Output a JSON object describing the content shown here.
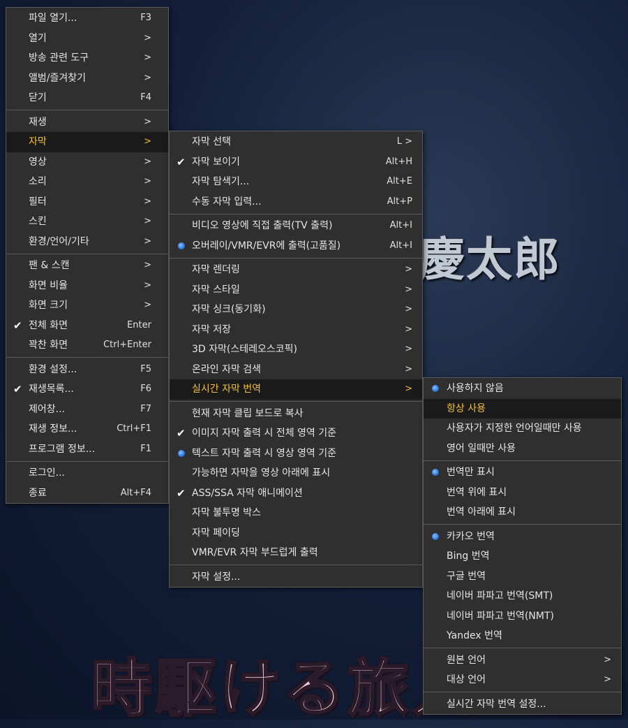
{
  "background": {
    "kanji": "慶太郎",
    "caption": "時駆ける旅人"
  },
  "menu_main": [
    {
      "label": "파일 열기...",
      "shortcut": "F3"
    },
    {
      "label": "열기",
      "shortcut": ">"
    },
    {
      "label": "방송 관련 도구",
      "shortcut": ">"
    },
    {
      "label": "앨범/즐겨찾기",
      "shortcut": ">"
    },
    {
      "label": "닫기",
      "shortcut": "F4"
    },
    {
      "label": "재생",
      "shortcut": ">"
    },
    {
      "label": "자막",
      "shortcut": ">"
    },
    {
      "label": "영상",
      "shortcut": ">"
    },
    {
      "label": "소리",
      "shortcut": ">"
    },
    {
      "label": "필터",
      "shortcut": ">"
    },
    {
      "label": "스킨",
      "shortcut": ">"
    },
    {
      "label": "환경/언어/기타",
      "shortcut": ">"
    },
    {
      "label": "팬 & 스캔",
      "shortcut": ">"
    },
    {
      "label": "화면 비율",
      "shortcut": ">"
    },
    {
      "label": "화면 크기",
      "shortcut": ">"
    },
    {
      "label": "전체 화면",
      "shortcut": "Enter"
    },
    {
      "label": "꽉찬 화면",
      "shortcut": "Ctrl+Enter"
    },
    {
      "label": "환경 설정...",
      "shortcut": "F5"
    },
    {
      "label": "재생목록...",
      "shortcut": "F6"
    },
    {
      "label": "제어창...",
      "shortcut": "F7"
    },
    {
      "label": "재생 정보...",
      "shortcut": "Ctrl+F1"
    },
    {
      "label": "프로그램 정보...",
      "shortcut": "F1"
    },
    {
      "label": "로그인...",
      "shortcut": ""
    },
    {
      "label": "종료",
      "shortcut": "Alt+F4"
    }
  ],
  "menu_subtitle": [
    {
      "label": "자막 선택",
      "shortcut": "L >"
    },
    {
      "label": "자막 보이기",
      "shortcut": "Alt+H"
    },
    {
      "label": "자막 탐색기...",
      "shortcut": "Alt+E"
    },
    {
      "label": "수동 자막 입력...",
      "shortcut": "Alt+P"
    },
    {
      "label": "비디오 영상에 직접 출력(TV 출력)",
      "shortcut": "Alt+I"
    },
    {
      "label": "오버레이/VMR/EVR에 출력(고품질)",
      "shortcut": "Alt+I"
    },
    {
      "label": "자막 렌더링",
      "shortcut": ">"
    },
    {
      "label": "자막 스타일",
      "shortcut": ">"
    },
    {
      "label": "자막 싱크(동기화)",
      "shortcut": ">"
    },
    {
      "label": "자막 저장",
      "shortcut": ">"
    },
    {
      "label": "3D 자막(스테레오스코픽)",
      "shortcut": ">"
    },
    {
      "label": "온라인 자막 검색",
      "shortcut": ">"
    },
    {
      "label": "실시간 자막 번역",
      "shortcut": ">"
    },
    {
      "label": "현재 자막 클립 보드로 복사",
      "shortcut": ""
    },
    {
      "label": "이미지 자막 출력 시 전체 영역 기준",
      "shortcut": ""
    },
    {
      "label": "텍스트 자막 출력 시 영상 영역 기준",
      "shortcut": ""
    },
    {
      "label": "가능하면 자막을 영상 아래에 표시",
      "shortcut": ""
    },
    {
      "label": "ASS/SSA 자막 애니메이션",
      "shortcut": ""
    },
    {
      "label": "자막 불투명 박스",
      "shortcut": ""
    },
    {
      "label": "자막 페이딩",
      "shortcut": ""
    },
    {
      "label": "VMR/EVR 자막 부드럽게 출력",
      "shortcut": ""
    },
    {
      "label": "자막 설정...",
      "shortcut": ""
    }
  ],
  "menu_translate": [
    {
      "label": "사용하지 않음",
      "shortcut": ""
    },
    {
      "label": "항상 사용",
      "shortcut": ""
    },
    {
      "label": "사용자가 지정한 언어일때만 사용",
      "shortcut": ""
    },
    {
      "label": "영어 일때만 사용",
      "shortcut": ""
    },
    {
      "label": "번역만 표시",
      "shortcut": ""
    },
    {
      "label": "번역 위에 표시",
      "shortcut": ""
    },
    {
      "label": "번역 아래에 표시",
      "shortcut": ""
    },
    {
      "label": "카카오 번역",
      "shortcut": ""
    },
    {
      "label": "Bing 번역",
      "shortcut": ""
    },
    {
      "label": "구글 번역",
      "shortcut": ""
    },
    {
      "label": "네이버 파파고 번역(SMT)",
      "shortcut": ""
    },
    {
      "label": "네이버 파파고 번역(NMT)",
      "shortcut": ""
    },
    {
      "label": "Yandex 번역",
      "shortcut": ""
    },
    {
      "label": "원본 언어",
      "shortcut": ">"
    },
    {
      "label": "대상 언어",
      "shortcut": ">"
    },
    {
      "label": "실시간 자막 번역 설정...",
      "shortcut": ""
    }
  ]
}
